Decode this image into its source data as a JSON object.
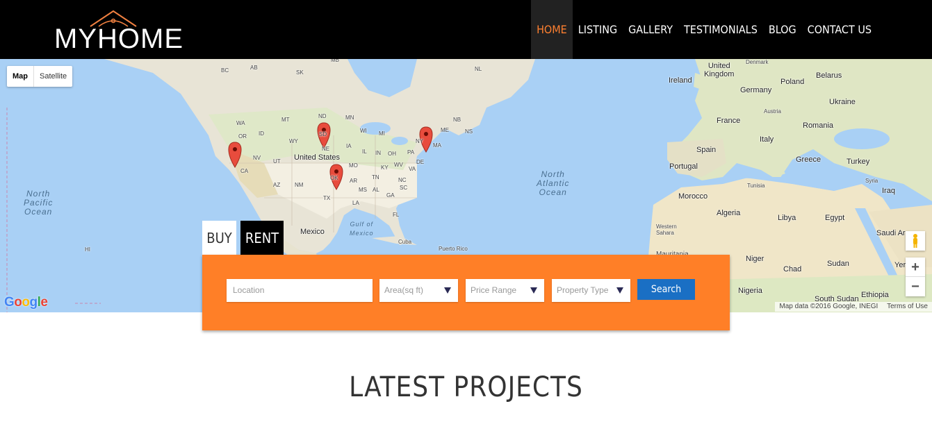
{
  "header": {
    "logo_text": "MYHOME",
    "nav": [
      {
        "label": "HOME",
        "active": true
      },
      {
        "label": "LISTING"
      },
      {
        "label": "GALLERY"
      },
      {
        "label": "TESTIMONIALS"
      },
      {
        "label": "BLOG"
      },
      {
        "label": "CONTACT US"
      }
    ]
  },
  "map": {
    "type_buttons": {
      "map": "Map",
      "satellite": "Satellite"
    },
    "google_logo": "Google",
    "attribution": "Map data ©2016 Google, INEGI",
    "terms": "Terms of Use",
    "zoom_in": "+",
    "zoom_out": "−",
    "labels": {
      "bc": "BC",
      "sk": "SK",
      "mb": "MB",
      "ab": "AB",
      "nl": "NL",
      "wa": "WA",
      "mt": "MT",
      "nd": "ND",
      "mn": "MN",
      "or": "OR",
      "id": "ID",
      "wy": "WY",
      "sd": "SD",
      "wi": "WI",
      "mi": "MI",
      "ne": "NE",
      "ia": "IA",
      "nv": "NV",
      "ut": "UT",
      "co": "CO",
      "ca": "CA",
      "az": "AZ",
      "nm": "NM",
      "ks": "KS",
      "mo": "MO",
      "il": "IL",
      "in": "IN",
      "oh": "OH",
      "pa": "PA",
      "ny": "NY",
      "ky": "KY",
      "wv": "WV",
      "va": "VA",
      "nc": "NC",
      "tn": "TN",
      "ok": "OK",
      "ar": "AR",
      "ms": "MS",
      "al": "AL",
      "ga": "GA",
      "sc": "SC",
      "tx": "TX",
      "la": "LA",
      "fl": "FL",
      "me": "ME",
      "ns": "NS",
      "nb": "NB",
      "ma": "MA",
      "de": "DE",
      "nh": "NH",
      "md": "MD",
      "hi": "HI",
      "united_states": "United States",
      "mexico": "Mexico",
      "gulf": "Gulf of\nMexico",
      "cuba": "Cuba",
      "puerto_rico": "Puerto Rico",
      "north_pacific": "North\nPacific\nOcean",
      "north_atlantic": "North\nAtlantic\nOcean",
      "united_kingdom": "United\nKingdom",
      "ireland": "Ireland",
      "denmark": "Denmark",
      "belarus": "Belarus",
      "germany": "Germany",
      "poland": "Poland",
      "ukraine": "Ukraine",
      "france": "France",
      "austria": "Austria",
      "romania": "Romania",
      "italy": "Italy",
      "spain": "Spain",
      "portugal": "Portugal",
      "greece": "Greece",
      "turkey": "Turkey",
      "tunisia": "Tunisia",
      "syria": "Syria",
      "morocco": "Morocco",
      "iraq": "Iraq",
      "algeria": "Algeria",
      "libya": "Libya",
      "egypt": "Egypt",
      "western_sahara": "Western\nSahara",
      "saudi_arabia": "Saudi Ar",
      "mauritania": "Mauritania",
      "niger": "Niger",
      "chad": "Chad",
      "sudan": "Sudan",
      "yemen": "Yer",
      "nigeria": "Nigeria",
      "south_sudan": "South Sudan",
      "ethiopia": "Ethiopia"
    }
  },
  "search": {
    "tabs": {
      "buy": "BUY",
      "rent": "RENT"
    },
    "location_placeholder": "Location",
    "area_label": "Area(sq ft)",
    "price_label": "Price Range",
    "type_label": "Property Type",
    "search_label": "Search"
  },
  "section": {
    "latest_title": "LATEST PROJECTS"
  },
  "colors": {
    "accent": "#ff7f27",
    "search_button": "#1a6fc4",
    "marker": "#e84c3d"
  }
}
